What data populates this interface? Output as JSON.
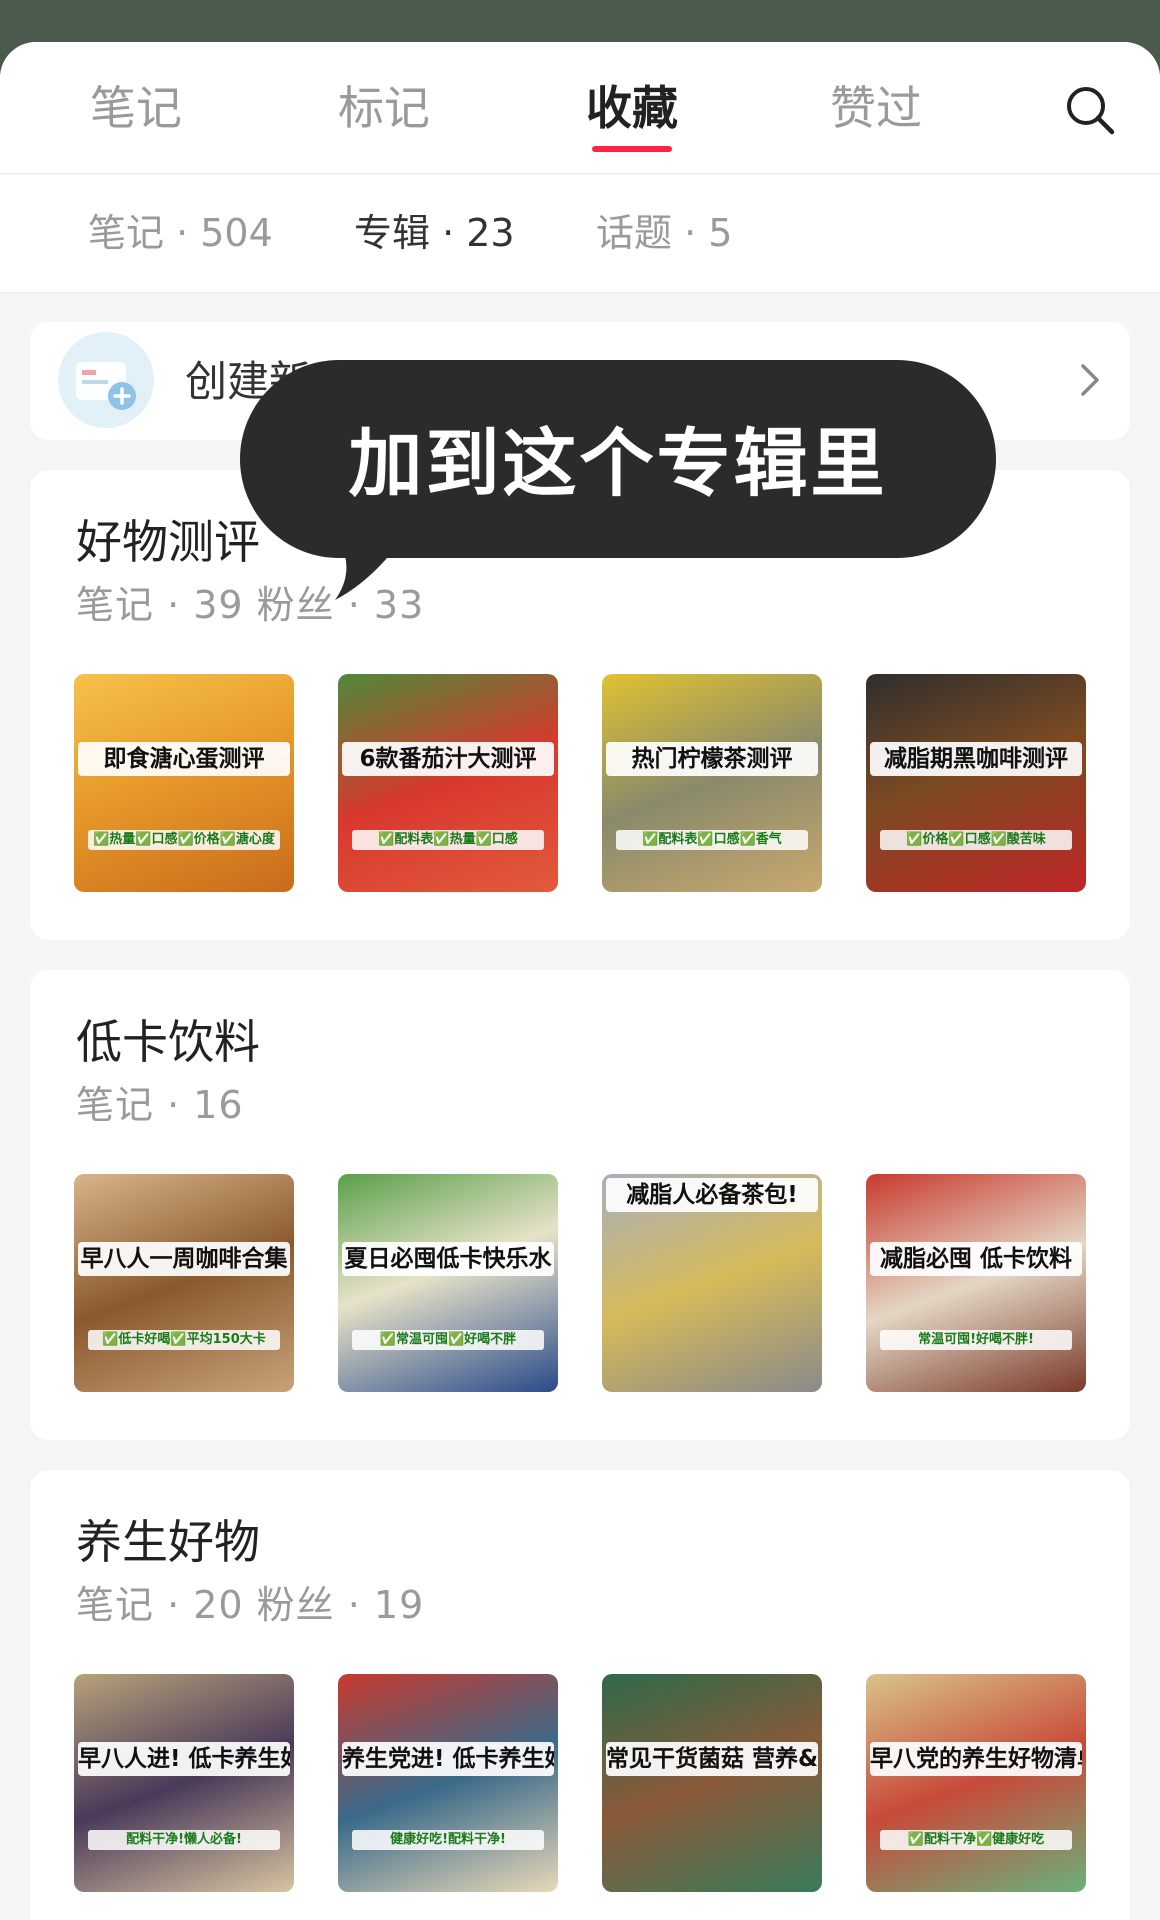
{
  "tabs": [
    {
      "label": "笔记"
    },
    {
      "label": "标记"
    },
    {
      "label": "收藏"
    },
    {
      "label": "赞过"
    }
  ],
  "active_tab": "收藏",
  "subtabs": [
    {
      "label": "笔记 · 504"
    },
    {
      "label": "专辑 · 23"
    },
    {
      "label": "话题 · 5"
    }
  ],
  "create_album_label": "创建新专辑",
  "overlay_bubble_text": "加到这个专辑里",
  "albums": [
    {
      "title": "好物测评",
      "meta": "笔记 · 39   粉丝 · 33",
      "thumbs": [
        {
          "label": "即食溏心蛋测评",
          "sub": "✅热量✅口感✅价格✅溏心度"
        },
        {
          "label": "6款番茄汁大测评",
          "sub": "✅配料表✅热量✅口感"
        },
        {
          "label": "热门柠檬茶测评",
          "sub": "✅配料表✅口感✅香气"
        },
        {
          "label": "减脂期黑咖啡测评",
          "sub": "✅价格✅口感✅酸苦味"
        }
      ]
    },
    {
      "title": "低卡饮料",
      "meta": "笔记 · 16",
      "thumbs": [
        {
          "label": "早八人一周咖啡合集",
          "sub": "✅低卡好喝✅平均150大卡"
        },
        {
          "label": "夏日必囤低卡快乐水",
          "sub": "✅常温可囤✅好喝不胖"
        },
        {
          "label": "减脂人必备茶包!",
          "sub": ""
        },
        {
          "label": "减脂必囤 低卡饮料",
          "sub": "常温可囤!好喝不胖!"
        }
      ]
    },
    {
      "title": "养生好物",
      "meta": "笔记 · 20   粉丝 · 19",
      "thumbs": [
        {
          "label": "早八人进! 低卡养生好物(二)",
          "sub": "配料干净!懒人必备!"
        },
        {
          "label": "养生党进! 低卡养生好物(一)",
          "sub": "健康好吃!配料干净!"
        },
        {
          "label": "常见干货菌菇 营养&挑选指南",
          "sub": ""
        },
        {
          "label": "早八党的养生好物清单",
          "sub": "✅配料干净✅健康好吃"
        }
      ]
    }
  ],
  "colors": {
    "accent": "#ff2442",
    "bubble_bg": "#2b2b2b",
    "top_backdrop": "#4a5a4c"
  },
  "icons": {
    "search": "search-icon",
    "chevron": "chevron-right-icon",
    "create": "album-add-icon"
  }
}
